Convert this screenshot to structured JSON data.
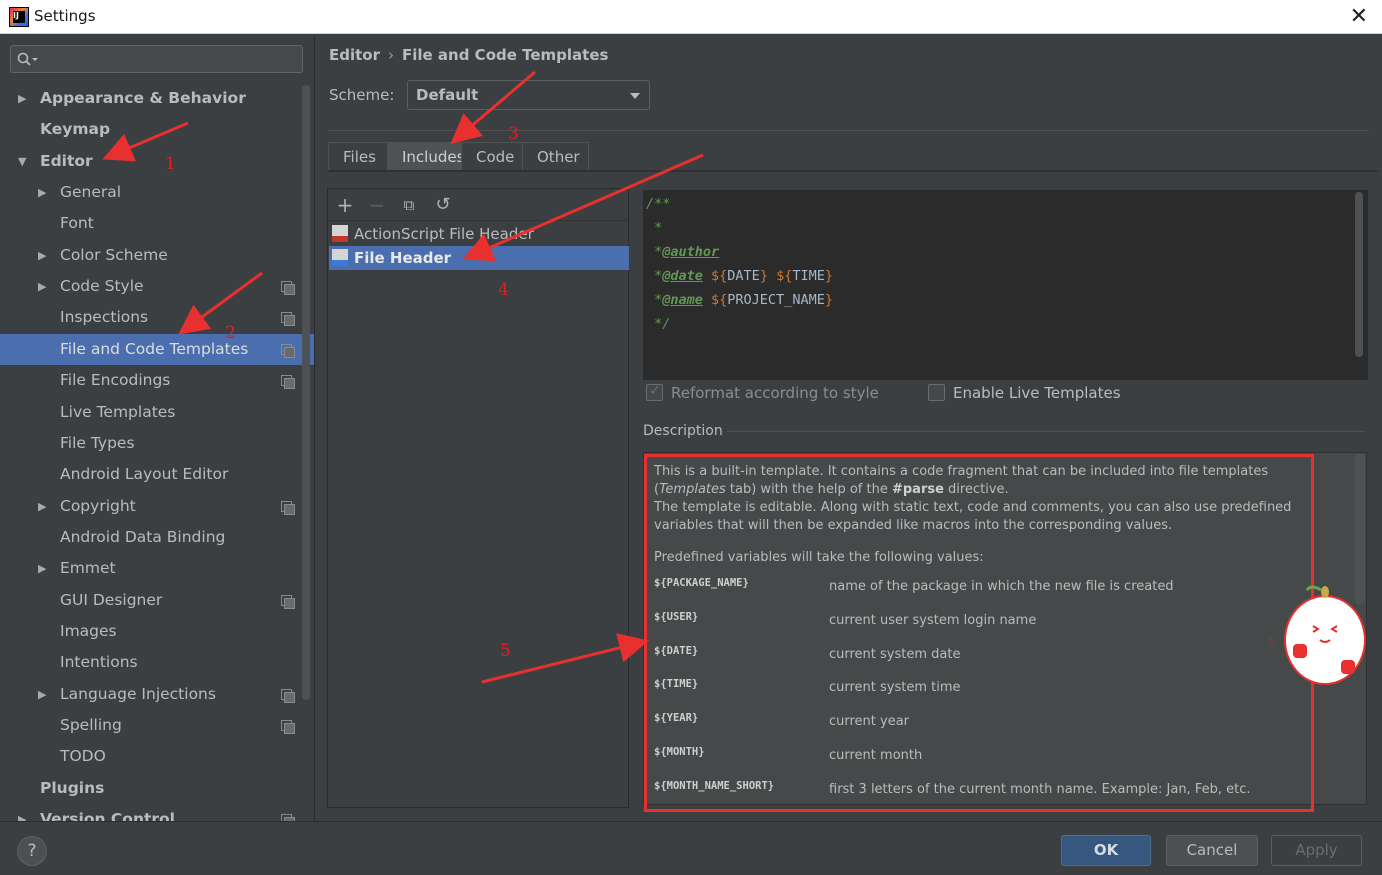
{
  "window": {
    "title": "Settings"
  },
  "sidebar": {
    "search_placeholder": "",
    "items": [
      {
        "label": "Appearance & Behavior",
        "level": 0,
        "arrow": "▶",
        "bold": true
      },
      {
        "label": "Keymap",
        "level": 0,
        "arrow": "",
        "bold": true
      },
      {
        "label": "Editor",
        "level": 0,
        "arrow": "▼",
        "bold": true
      },
      {
        "label": "General",
        "level": 1,
        "arrow": "▶"
      },
      {
        "label": "Font",
        "level": 1,
        "arrow": ""
      },
      {
        "label": "Color Scheme",
        "level": 1,
        "arrow": "▶"
      },
      {
        "label": "Code Style",
        "level": 1,
        "arrow": "▶",
        "copy": true
      },
      {
        "label": "Inspections",
        "level": 1,
        "arrow": "",
        "copy": true
      },
      {
        "label": "File and Code Templates",
        "level": 1,
        "arrow": "",
        "copy": true,
        "selected": true
      },
      {
        "label": "File Encodings",
        "level": 1,
        "arrow": "",
        "copy": true
      },
      {
        "label": "Live Templates",
        "level": 1,
        "arrow": ""
      },
      {
        "label": "File Types",
        "level": 1,
        "arrow": ""
      },
      {
        "label": "Android Layout Editor",
        "level": 1,
        "arrow": ""
      },
      {
        "label": "Copyright",
        "level": 1,
        "arrow": "▶",
        "copy": true
      },
      {
        "label": "Android Data Binding",
        "level": 1,
        "arrow": ""
      },
      {
        "label": "Emmet",
        "level": 1,
        "arrow": "▶"
      },
      {
        "label": "GUI Designer",
        "level": 1,
        "arrow": "",
        "copy": true
      },
      {
        "label": "Images",
        "level": 1,
        "arrow": ""
      },
      {
        "label": "Intentions",
        "level": 1,
        "arrow": ""
      },
      {
        "label": "Language Injections",
        "level": 1,
        "arrow": "▶",
        "copy": true
      },
      {
        "label": "Spelling",
        "level": 1,
        "arrow": "",
        "copy": true
      },
      {
        "label": "TODO",
        "level": 1,
        "arrow": ""
      },
      {
        "label": "Plugins",
        "level": 0,
        "arrow": "",
        "bold": true
      },
      {
        "label": "Version Control",
        "level": 0,
        "arrow": "▶",
        "bold": true,
        "copy": true
      }
    ]
  },
  "main": {
    "breadcrumb": {
      "part1": "Editor",
      "separator": "›",
      "part2": "File and Code Templates"
    },
    "scheme": {
      "label": "Scheme:",
      "value": "Default"
    },
    "tabs": [
      "Files",
      "Includes",
      "Code",
      "Other"
    ],
    "active_tab": "Includes",
    "templates": [
      {
        "label": "ActionScript File Header"
      },
      {
        "label": "File Header",
        "selected": true
      }
    ],
    "editor_lines": [
      [
        "/**"
      ],
      [
        " *"
      ],
      [
        " *",
        "@author",
        ""
      ],
      [
        " *",
        "@date",
        " ${",
        "DATE",
        "} ${",
        "TIME",
        "}"
      ],
      [
        " *",
        "@name",
        " ${",
        "PROJECT_NAME",
        "}"
      ],
      [
        " */"
      ]
    ],
    "reformat_label": "Reformat according to style",
    "live_templates_label": "Enable Live Templates",
    "description_label": "Description",
    "description_p1_a": "This is a built-in template. It contains a code fragment that can be included into file templates (",
    "description_p1_italic": "Templates",
    "description_p1_b": " tab) with the help of the ",
    "description_p1_bold": "#parse",
    "description_p1_c": " directive.",
    "description_p2": "The template is editable. Along with static text, code and comments, you can also use predefined variables that will then be expanded like macros into the corresponding values.",
    "description_p3": "Predefined variables will take the following values:",
    "variables": [
      {
        "name": "${PACKAGE_NAME}",
        "desc": "name of the package in which the new file is created"
      },
      {
        "name": "${USER}",
        "desc": "current user system login name"
      },
      {
        "name": "${DATE}",
        "desc": "current system date"
      },
      {
        "name": "${TIME}",
        "desc": "current system time"
      },
      {
        "name": "${YEAR}",
        "desc": "current year"
      },
      {
        "name": "${MONTH}",
        "desc": "current month"
      },
      {
        "name": "${MONTH_NAME_SHORT}",
        "desc": "first 3 letters of the current month name. Example: Jan, Feb, etc."
      }
    ]
  },
  "buttons": {
    "ok": "OK",
    "cancel": "Cancel",
    "apply": "Apply",
    "help": "?"
  },
  "annotations": [
    "1",
    "2",
    "3",
    "4",
    "5"
  ],
  "colors": {
    "accent": "#4b6eaf",
    "annotation": "#e02020",
    "background": "#3c3f41"
  }
}
